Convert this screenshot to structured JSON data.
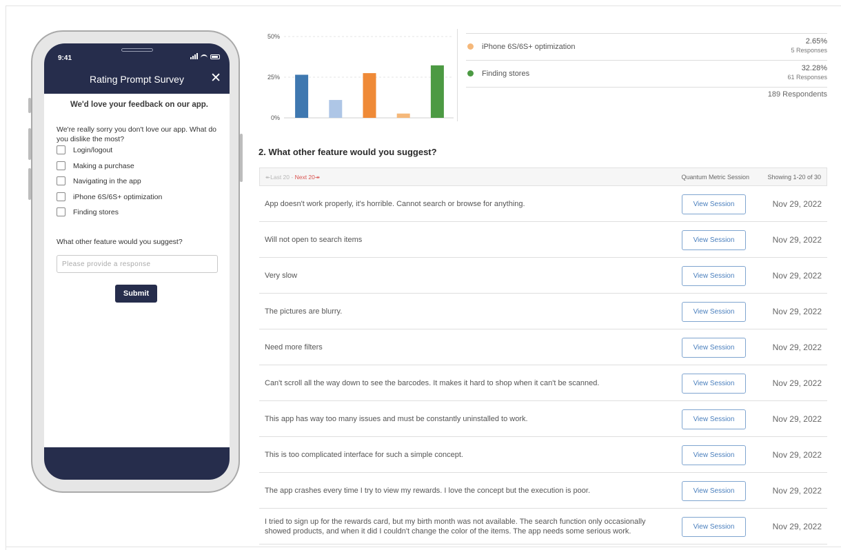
{
  "phone": {
    "status_time": "9:41",
    "title": "Rating Prompt Survey",
    "close_glyph": "✕",
    "subtitle": "We'd love your feedback on our app.",
    "question": "We're really sorry you don't love our app. What do you dislike the most?",
    "options": [
      "Login/logout",
      "Making a purchase",
      "Navigating in the app",
      "iPhone 6S/6S+ optimization",
      "Finding stores"
    ],
    "question2": "What other feature would you suggest?",
    "input_placeholder": "Please provide a response",
    "submit_label": "Submit",
    "header_color": "#262d4c"
  },
  "chart_data": {
    "type": "bar",
    "categories": [
      "Login/logout",
      "Making a purchase",
      "Navigating in the app",
      "iPhone 6S/6S+ optimization",
      "Finding stores"
    ],
    "values": [
      26.5,
      11,
      27.5,
      2.65,
      32.28
    ],
    "colors": [
      "#3f78b0",
      "#aec6e6",
      "#ef8a37",
      "#f5b87a",
      "#4c9a43"
    ],
    "y_ticks": [
      "50%",
      "25%",
      "0%"
    ],
    "ylim": [
      0,
      50
    ],
    "grid": true
  },
  "legend": [
    {
      "label": "iPhone 6S/6S+ optimization",
      "percent": "2.65%",
      "responses": "5 Responses",
      "color": "#f5b87a"
    },
    {
      "label": "Finding stores",
      "percent": "32.28%",
      "responses": "61 Responses",
      "color": "#4c9a43"
    }
  ],
  "respondents": "189 Respondents",
  "question2_title": "2. What other feature would you suggest?",
  "pager": {
    "last": "↞Last 20",
    "separator": " - ",
    "next": "Next 20↠",
    "col_session": "Quantum Metric Session",
    "col_showing": "Showing 1-20 of 30"
  },
  "view_label": "View Session",
  "responses": [
    {
      "text": "App doesn't work properly, it's horrible. Cannot search or browse for anything.",
      "date": "Nov 29, 2022"
    },
    {
      "text": "Will not open to search items",
      "date": "Nov 29, 2022"
    },
    {
      "text": "Very slow",
      "date": "Nov 29, 2022"
    },
    {
      "text": "The pictures are blurry.",
      "date": "Nov 29, 2022"
    },
    {
      "text": "Need more filters",
      "date": "Nov 29, 2022"
    },
    {
      "text": "Can't scroll all the way down to see the barcodes. It makes it hard to shop when it can't be scanned.",
      "date": "Nov 29, 2022"
    },
    {
      "text": "This app has way too many issues and must be constantly uninstalled to work.",
      "date": "Nov 29, 2022"
    },
    {
      "text": "This is too complicated interface for such a simple concept.",
      "date": "Nov 29, 2022"
    },
    {
      "text": "The app crashes every time I try to view my rewards. I love the concept but the execution is poor.",
      "date": "Nov 29, 2022"
    },
    {
      "text": "I tried to sign up for the rewards card, but my birth month was not available. The search function only occasionally showed products, and when it did I couldn't change the color of the items. The app needs some serious work.",
      "date": "Nov 29, 2022"
    }
  ]
}
